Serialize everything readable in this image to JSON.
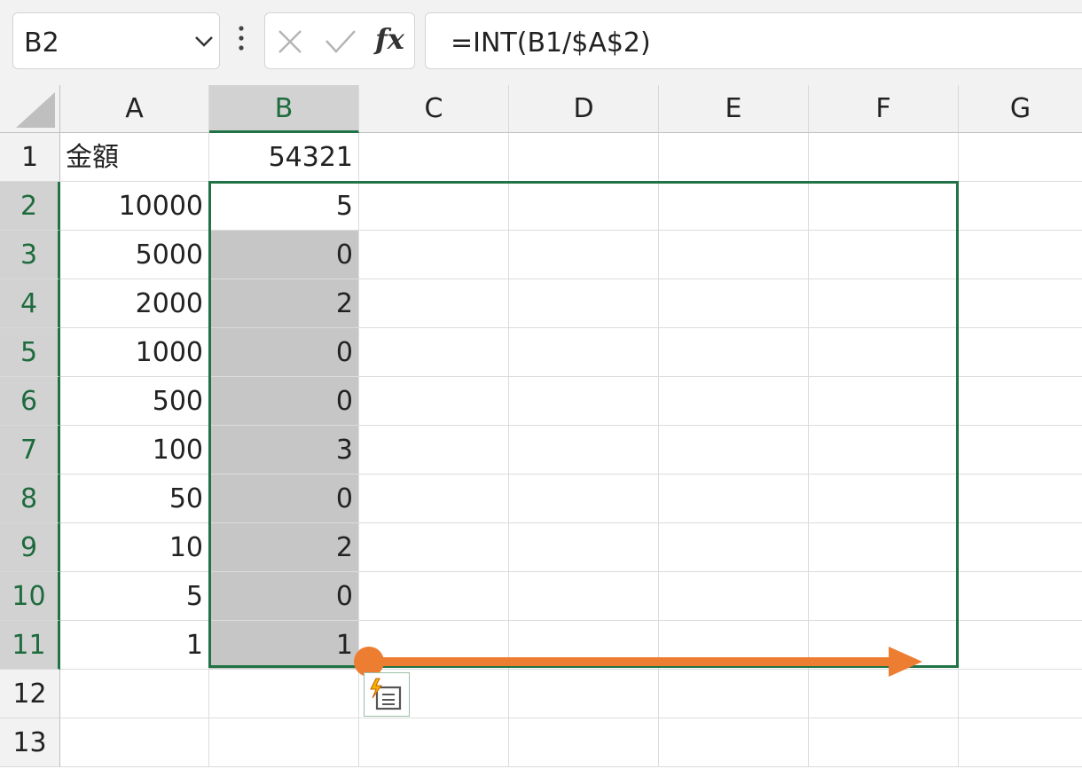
{
  "name_box": {
    "value": "B2"
  },
  "formula_bar": {
    "fx_label": "fx",
    "formula": "=INT(B1/$A$2)"
  },
  "columns": [
    "A",
    "B",
    "C",
    "D",
    "E",
    "F",
    "G"
  ],
  "rows": [
    "1",
    "2",
    "3",
    "4",
    "5",
    "6",
    "7",
    "8",
    "9",
    "10",
    "11",
    "12",
    "13"
  ],
  "cells": {
    "A1": "金額",
    "B1": "54321",
    "A2": "10000",
    "B2": "5",
    "A3": "5000",
    "B3": "0",
    "A4": "2000",
    "B4": "2",
    "A5": "1000",
    "B5": "0",
    "A6": "500",
    "B6": "0",
    "A7": "100",
    "B7": "3",
    "A8": "50",
    "B8": "0",
    "A9": "10",
    "B9": "2",
    "A10": "5",
    "B10": "0",
    "A11": "1",
    "B11": "1"
  },
  "active_cell": "B2",
  "colors": {
    "selection": "#217346",
    "fill_arrow": "#ed7d31",
    "highlight": "#c6c6c6"
  },
  "icons": {
    "name_box_dropdown": "chevron-down-icon",
    "cancel": "x-icon",
    "enter": "check-icon",
    "autofill_options": "flash-fill-icon"
  }
}
